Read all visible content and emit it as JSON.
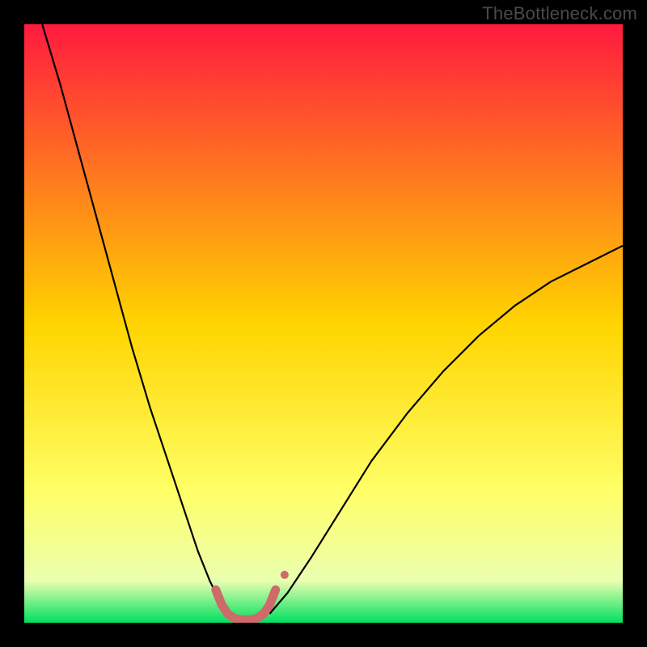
{
  "watermark": "TheBottleneck.com",
  "chart_data": {
    "type": "line",
    "title": "",
    "xlabel": "",
    "ylabel": "",
    "xlim": [
      0,
      100
    ],
    "ylim": [
      0,
      100
    ],
    "grid": false,
    "legend": "none",
    "background_gradient": {
      "stops": [
        {
          "pos": 0.0,
          "color": "#ff1a3f"
        },
        {
          "pos": 0.5,
          "color": "#ffd400"
        },
        {
          "pos": 0.78,
          "color": "#ffff66"
        },
        {
          "pos": 0.93,
          "color": "#eaffb0"
        },
        {
          "pos": 1.0,
          "color": "#00e060"
        }
      ]
    },
    "series": [
      {
        "name": "left-branch",
        "color": "#000000",
        "width": 2.2,
        "x": [
          3,
          6,
          9,
          12,
          15,
          18,
          21,
          24,
          27,
          29,
          31,
          33,
          34.5
        ],
        "y": [
          100,
          90,
          79,
          68,
          57,
          46,
          36,
          27,
          18,
          12,
          7,
          3,
          1
        ]
      },
      {
        "name": "right-branch",
        "color": "#000000",
        "width": 2.2,
        "x": [
          41,
          44,
          48,
          53,
          58,
          64,
          70,
          76,
          82,
          88,
          94,
          100
        ],
        "y": [
          1.5,
          5,
          11,
          19,
          27,
          35,
          42,
          48,
          53,
          57,
          60,
          63
        ]
      },
      {
        "name": "trough-marker",
        "color": "#cf6a6a",
        "width": 11,
        "linecap": "round",
        "x": [
          32,
          33,
          34,
          35,
          36,
          37,
          38,
          39,
          40,
          41,
          42
        ],
        "y": [
          5.5,
          3.0,
          1.5,
          0.8,
          0.5,
          0.5,
          0.5,
          0.8,
          1.5,
          3.0,
          5.5
        ]
      }
    ],
    "markers": [
      {
        "name": "trough-end-dot",
        "x": 43.5,
        "y": 8,
        "r": 5,
        "color": "#cf6a6a"
      }
    ]
  }
}
